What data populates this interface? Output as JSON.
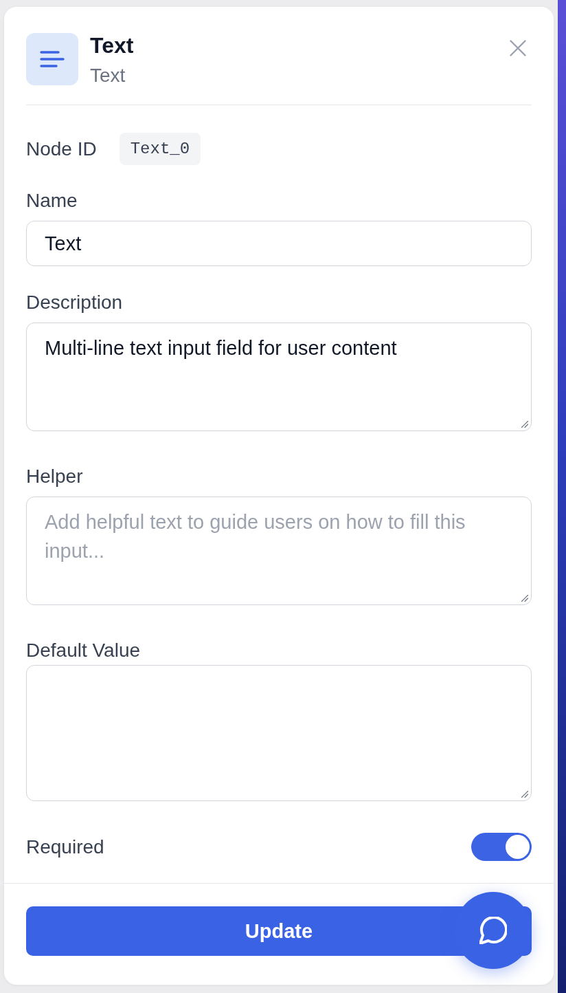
{
  "header": {
    "title": "Text",
    "subtitle": "Text"
  },
  "node_id": {
    "label": "Node ID",
    "value": "Text_0"
  },
  "fields": [
    {
      "label": "Name",
      "kind": "input",
      "value": "Text"
    },
    {
      "label": "Description",
      "kind": "textarea",
      "value": "Multi-line text input field for user content"
    },
    {
      "label": "Helper",
      "kind": "textarea",
      "placeholder": "Add helpful text to guide users on how to fill this input..."
    },
    {
      "label": "Default Value",
      "kind": "textarea"
    }
  ],
  "required": {
    "label": "Required",
    "on": true
  },
  "footer": {
    "button": "Update"
  }
}
